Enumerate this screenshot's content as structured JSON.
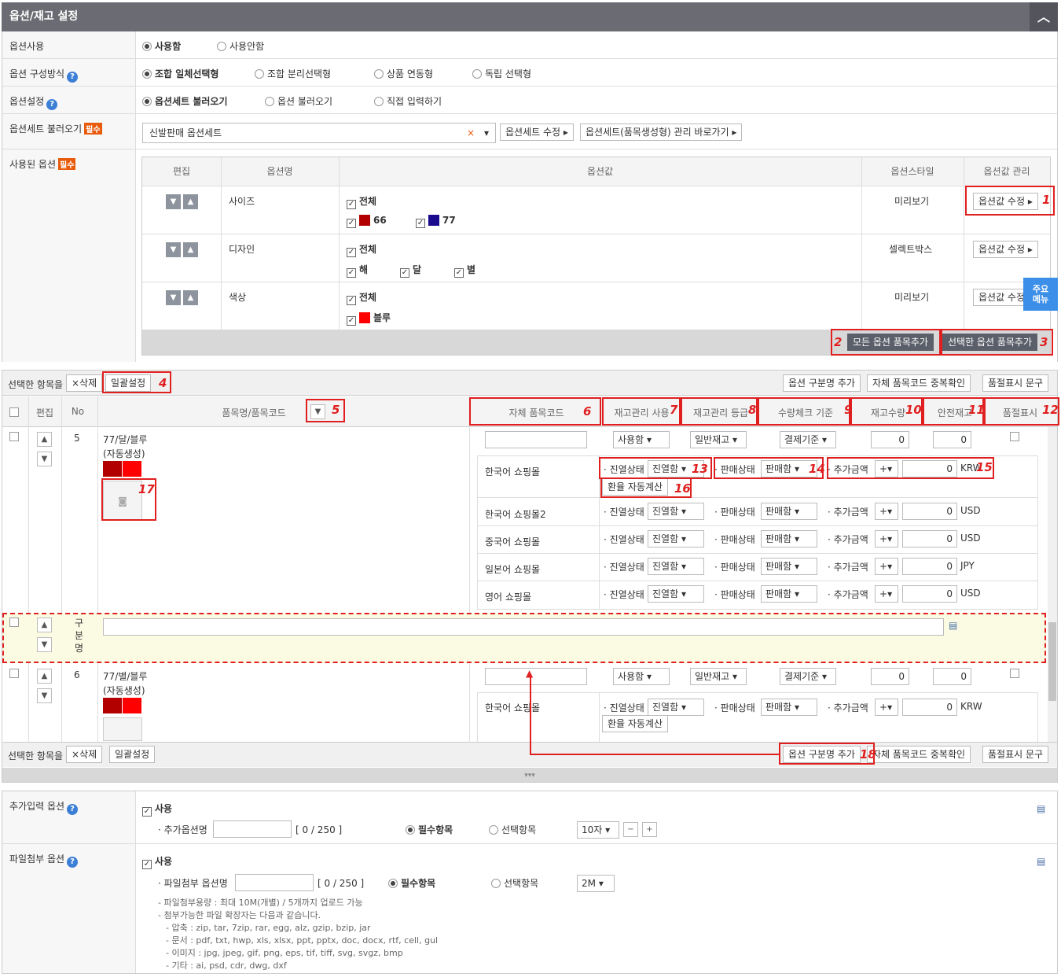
{
  "header": {
    "title": "옵션/재고 설정",
    "toggle": "︿"
  },
  "rows": {
    "use": {
      "label": "옵션사용",
      "opts": [
        "사용함",
        "사용안함"
      ]
    },
    "compose": {
      "label": "옵션 구성방식",
      "opts": [
        "조합 일체선택형",
        "조합 분리선택형",
        "상품 연동형",
        "독립 선택형"
      ]
    },
    "setting": {
      "label": "옵션설정",
      "opts": [
        "옵션세트 불러오기",
        "옵션 불러오기",
        "직접 입력하기"
      ]
    },
    "setload": {
      "label": "옵션세트 불러오기",
      "req": "필수",
      "value": "신발판매 옵션세트",
      "clear": "×",
      "btn1": "옵션세트 수정",
      "btn2": "옵션세트(품목생성형) 관리 바로가기"
    },
    "used": {
      "label": "사용된 옵션",
      "req": "필수"
    }
  },
  "optTable": {
    "headers": [
      "편집",
      "옵션명",
      "옵션값",
      "옵션스타일",
      "옵션값 관리"
    ],
    "items": [
      {
        "name": "사이즈",
        "all": "전체",
        "vals": [
          {
            "t": "66",
            "c": "#b20000"
          },
          {
            "t": "77",
            "c": "#1a0a8c"
          }
        ],
        "style": "미리보기",
        "btn": "옵션값 수정"
      },
      {
        "name": "디자인",
        "all": "전체",
        "vals": [
          {
            "t": "해"
          },
          {
            "t": "달"
          },
          {
            "t": "별"
          }
        ],
        "style": "셀렉트박스",
        "btn": "옵션값 수정"
      },
      {
        "name": "색상",
        "all": "전체",
        "vals": [
          {
            "t": "블루",
            "c": "#ff0000"
          }
        ],
        "style": "미리보기",
        "btn": "옵션값 수정"
      }
    ],
    "addAll": "모든 옵션 품목추가",
    "addSel": "선택한 옵션 품목추가"
  },
  "floatMenu": "주요\n메뉴",
  "toolbar": {
    "selected": "선택한 항목을",
    "delete": "×삭제",
    "batch": "일괄설정",
    "addDivider": "옵션 구분명 추가",
    "dupCheck": "자체 품목코드 중복확인",
    "soldout": "품절표시 문구"
  },
  "itemHead": {
    "edit": "편집",
    "no": "No",
    "name": "품목명/품목코드",
    "filter": "▼",
    "code": "자체 품목코드",
    "stockUse": "재고관리 사용",
    "stockGrade": "재고관리 등급",
    "qtyCheck": "수량체크 기준",
    "stockQty": "재고수량",
    "safety": "안전재고",
    "soldout": "품절표시"
  },
  "items": [
    {
      "no": "5",
      "name": "77/달/블루",
      "auto": "(자동생성)",
      "use": "사용함",
      "grade": "일반재고",
      "check": "결제기준",
      "qty": "0",
      "safe": "0",
      "malls": [
        {
          "name": "한국어 쇼핑몰",
          "disp": "진열함",
          "sale": "판매함",
          "sign": "+",
          "amt": "0",
          "cur": "KRW",
          "fx": "환율 자동계산"
        },
        {
          "name": "한국어 쇼핑몰2",
          "disp": "진열함",
          "sale": "판매함",
          "sign": "+",
          "amt": "0",
          "cur": "USD"
        },
        {
          "name": "중국어 쇼핑몰",
          "disp": "진열함",
          "sale": "판매함",
          "sign": "+",
          "amt": "0",
          "cur": "USD"
        },
        {
          "name": "일본어 쇼핑몰",
          "disp": "진열함",
          "sale": "판매함",
          "sign": "+",
          "amt": "0",
          "cur": "JPY"
        },
        {
          "name": "영어 쇼핑몰",
          "disp": "진열함",
          "sale": "판매함",
          "sign": "+",
          "amt": "0",
          "cur": "USD"
        }
      ]
    },
    {
      "no": "6",
      "name": "77/별/블루",
      "auto": "(자동생성)",
      "use": "사용함",
      "grade": "일반재고",
      "check": "결제기준",
      "qty": "0",
      "safe": "0",
      "malls": [
        {
          "name": "한국어 쇼핑몰",
          "disp": "진열함",
          "sale": "판매함",
          "sign": "+",
          "amt": "0",
          "cur": "KRW",
          "fx": "환율 자동계산"
        }
      ]
    }
  ],
  "labels": {
    "disp": "진열상태",
    "sale": "판매상태",
    "amt": "추가금액"
  },
  "divider": {
    "label": "구\n분\n명"
  },
  "extra": {
    "label": "추가입력 옵션",
    "use": "사용",
    "name": "추가옵션명",
    "count": "[ 0 / 250 ]",
    "req": "필수항목",
    "opt": "선택항목",
    "size": "10자"
  },
  "file": {
    "label": "파일첨부 옵션",
    "use": "사용",
    "name": "파일첨부 옵션명",
    "count": "[ 0 / 250 ]",
    "req": "필수항목",
    "opt": "선택항목",
    "size": "2M",
    "notes": [
      "- 파일첨부용량 : 최대 10M(개별) / 5개까지 업로드 가능",
      "- 첨부가능한 파일 확장자는 다음과 같습니다.",
      "- 압축 : zip, tar, 7zip, rar, egg, alz, gzip, bzip, jar",
      "- 문서 : pdf, txt, hwp, xls, xlsx, ppt, pptx, doc, docx, rtf, cell, gul",
      "- 이미지 : jpg, jpeg, gif, png, eps, tif, tiff, svg, svgz, bmp",
      "- 기타 : ai, psd, cdr, dwg, dxf"
    ]
  },
  "markers": [
    "1",
    "2",
    "3",
    "4",
    "5",
    "6",
    "7",
    "8",
    "9",
    "10",
    "11",
    "12",
    "13",
    "14",
    "15",
    "16",
    "17",
    "18"
  ]
}
